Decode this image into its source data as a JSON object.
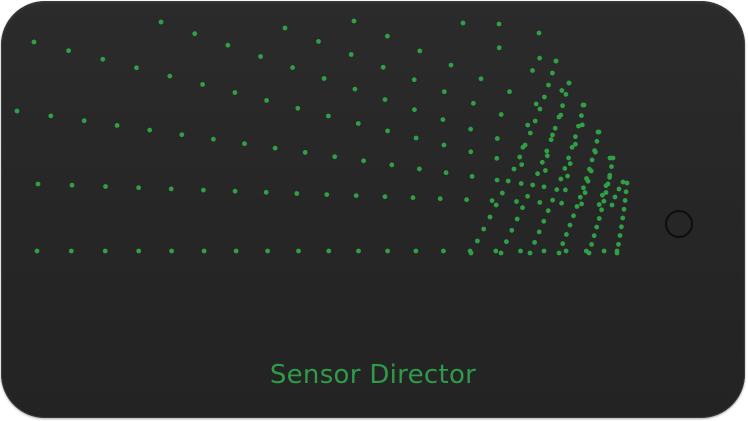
{
  "device": {
    "brand_label": "Sensor Director",
    "body_color": "#262626",
    "accent_color": "#2f9a49"
  },
  "dot_pattern": {
    "dot_color": "#2fa046",
    "icon": "sound-wave-dot-pattern"
  },
  "home_button": {
    "icon": "circle-button-icon"
  }
}
